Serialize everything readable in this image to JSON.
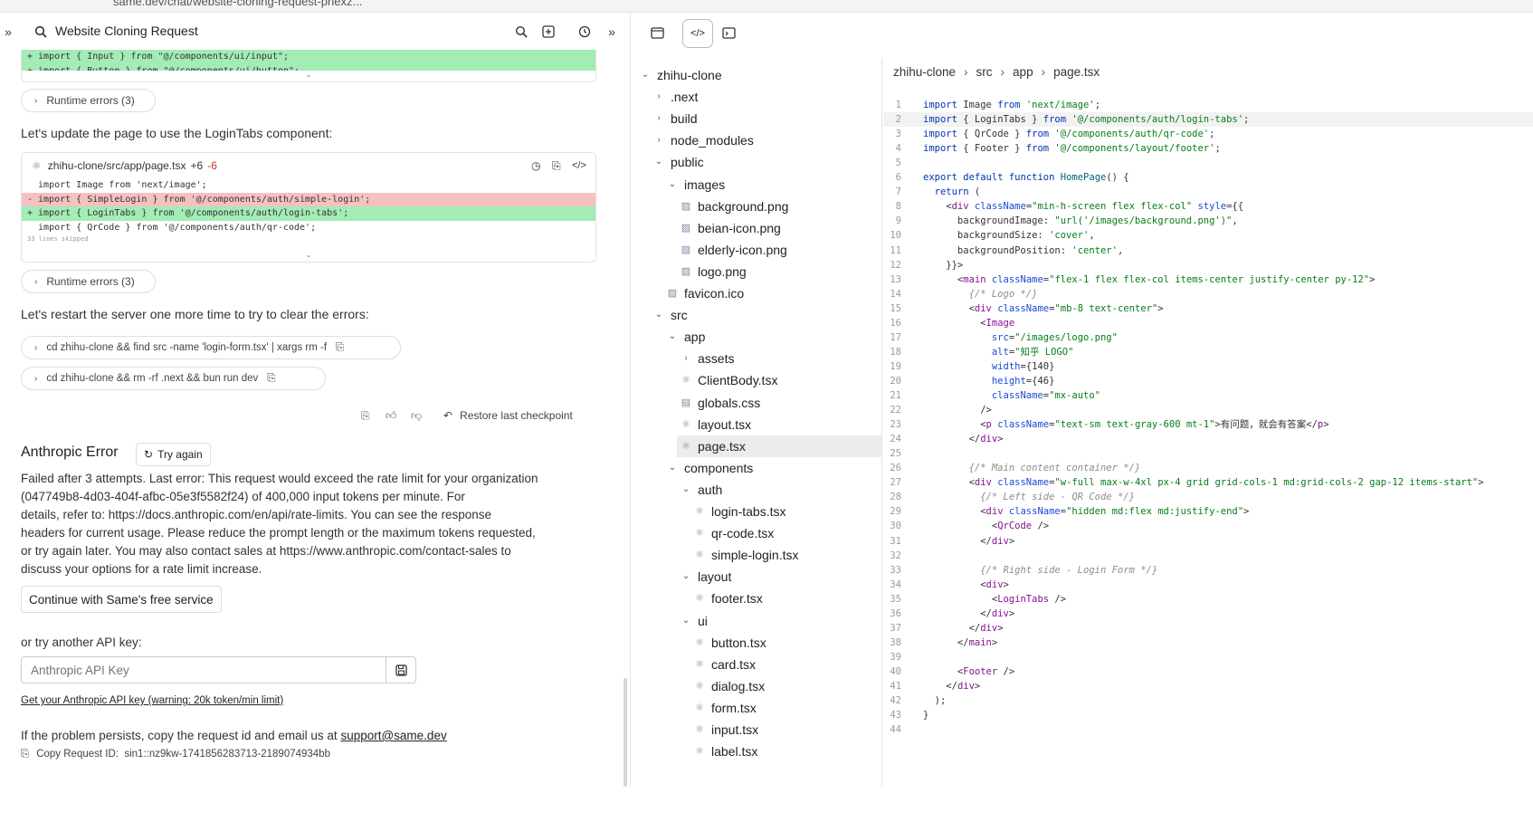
{
  "browser": {
    "url": "same.dev/chat/website-cloning-request-prlexz..."
  },
  "chat": {
    "title": "Website Cloning Request",
    "diff1": {
      "lines": [
        {
          "type": "add",
          "text": "+ import { Input } from \"@/components/ui/input\";"
        },
        {
          "type": "add",
          "text": "+ import { Button } from \"@/components/ui/button\";"
        }
      ]
    },
    "runtime_errors_1": "Runtime errors (3)",
    "msg_update": "Let's update the page to use the LoginTabs component:",
    "diff2": {
      "file": "zhihu-clone/src/app/page.tsx",
      "added": "+6",
      "removed": "-6",
      "lines": [
        {
          "type": "ctx",
          "text": "  import Image from 'next/image';"
        },
        {
          "type": "del",
          "text": "- import { SimpleLogin } from '@/components/auth/simple-login';"
        },
        {
          "type": "add",
          "text": "+ import { LoginTabs } from '@/components/auth/login-tabs';"
        },
        {
          "type": "ctx",
          "text": "  import { QrCode } from '@/components/auth/qr-code';"
        }
      ],
      "skipped": "33 lines skipped"
    },
    "runtime_errors_2": "Runtime errors (3)",
    "msg_restart": "Let's restart the server one more time to try to clear the errors:",
    "cmd1": "cd zhihu-clone && find src -name 'login-form.tsx' | xargs rm -f",
    "cmd2": "cd zhihu-clone && rm -rf .next && bun run dev",
    "restore": "Restore last checkpoint",
    "error_title": "Anthropic Error",
    "try_again": "Try again",
    "error_lines": [
      "Failed after 3 attempts. Last error: This request would exceed the rate limit for your organization",
      "(047749b8-4d03-404f-afbc-05e3f5582f24) of 400,000 input tokens per minute. For",
      "details, refer to: https://docs.anthropic.com/en/api/rate-limits. You can see the response",
      "headers for current usage. Please reduce the prompt length or the maximum tokens requested,",
      "or try again later. You may also contact sales at https://www.anthropic.com/contact-sales to",
      "discuss your options for a rate limit increase."
    ],
    "continue_button": "Continue with Same's free service",
    "or_try": "or try another API key:",
    "api_placeholder": "Anthropic API Key",
    "api_link": "Get your Anthropic API key (warning: 20k token/min limit)",
    "persist_text": "If the problem persists, copy the request id and email us at ",
    "support_email": "support@same.dev",
    "copy_request": "Copy Request ID:",
    "request_id": "sin1::nz9kw-1741856283713-2189074934bb"
  },
  "breadcrumb": [
    "zhihu-clone",
    "src",
    "app",
    "page.tsx"
  ],
  "tree": [
    {
      "label": "zhihu-clone",
      "depth": 0,
      "kind": "open"
    },
    {
      "label": ".next",
      "depth": 1,
      "kind": "closed"
    },
    {
      "label": "build",
      "depth": 1,
      "kind": "closed"
    },
    {
      "label": "node_modules",
      "depth": 1,
      "kind": "closed"
    },
    {
      "label": "public",
      "depth": 1,
      "kind": "open"
    },
    {
      "label": "images",
      "depth": 2,
      "kind": "open"
    },
    {
      "label": "background.png",
      "depth": 3,
      "kind": "img"
    },
    {
      "label": "beian-icon.png",
      "depth": 3,
      "kind": "img"
    },
    {
      "label": "elderly-icon.png",
      "depth": 3,
      "kind": "img"
    },
    {
      "label": "logo.png",
      "depth": 3,
      "kind": "img"
    },
    {
      "label": "favicon.ico",
      "depth": 2,
      "kind": "img"
    },
    {
      "label": "src",
      "depth": 1,
      "kind": "open"
    },
    {
      "label": "app",
      "depth": 2,
      "kind": "open"
    },
    {
      "label": "assets",
      "depth": 3,
      "kind": "closed"
    },
    {
      "label": "ClientBody.tsx",
      "depth": 3,
      "kind": "react"
    },
    {
      "label": "globals.css",
      "depth": 3,
      "kind": "css"
    },
    {
      "label": "layout.tsx",
      "depth": 3,
      "kind": "react"
    },
    {
      "label": "page.tsx",
      "depth": 3,
      "kind": "react",
      "selected": true
    },
    {
      "label": "components",
      "depth": 2,
      "kind": "open"
    },
    {
      "label": "auth",
      "depth": 3,
      "kind": "open"
    },
    {
      "label": "login-tabs.tsx",
      "depth": 4,
      "kind": "react"
    },
    {
      "label": "qr-code.tsx",
      "depth": 4,
      "kind": "react"
    },
    {
      "label": "simple-login.tsx",
      "depth": 4,
      "kind": "react"
    },
    {
      "label": "layout",
      "depth": 3,
      "kind": "open"
    },
    {
      "label": "footer.tsx",
      "depth": 4,
      "kind": "react"
    },
    {
      "label": "ui",
      "depth": 3,
      "kind": "open"
    },
    {
      "label": "button.tsx",
      "depth": 4,
      "kind": "react"
    },
    {
      "label": "card.tsx",
      "depth": 4,
      "kind": "react"
    },
    {
      "label": "dialog.tsx",
      "depth": 4,
      "kind": "react"
    },
    {
      "label": "form.tsx",
      "depth": 4,
      "kind": "react"
    },
    {
      "label": "input.tsx",
      "depth": 4,
      "kind": "react"
    },
    {
      "label": "label.tsx",
      "depth": 4,
      "kind": "react"
    }
  ],
  "code": [
    "import Image from 'next/image';",
    "import { LoginTabs } from '@/components/auth/login-tabs';",
    "import { QrCode } from '@/components/auth/qr-code';",
    "import { Footer } from '@/components/layout/footer';",
    "",
    "export default function HomePage() {",
    "  return (",
    "    <div className=\"min-h-screen flex flex-col\" style={{",
    "      backgroundImage: \"url('/images/background.png')\",",
    "      backgroundSize: 'cover',",
    "      backgroundPosition: 'center',",
    "    }}>",
    "      <main className=\"flex-1 flex flex-col items-center justify-center py-12\">",
    "        {/* Logo */}",
    "        <div className=\"mb-8 text-center\">",
    "          <Image",
    "            src=\"/images/logo.png\"",
    "            alt=\"知乎 LOGO\"",
    "            width={140}",
    "            height={46}",
    "            className=\"mx-auto\"",
    "          />",
    "          <p className=\"text-sm text-gray-600 mt-1\">有问题，就会有答案</p>",
    "        </div>",
    "",
    "        {/* Main content container */}",
    "        <div className=\"w-full max-w-4xl px-4 grid grid-cols-1 md:grid-cols-2 gap-12 items-start\">",
    "          {/* Left side - QR Code */}",
    "          <div className=\"hidden md:flex md:justify-end\">",
    "            <QrCode />",
    "          </div>",
    "",
    "          {/* Right side - Login Form */}",
    "          <div>",
    "            <LoginTabs />",
    "          </div>",
    "        </div>",
    "      </main>",
    "",
    "      <Footer />",
    "    </div>",
    "  );",
    "}",
    ""
  ],
  "active_line": 2
}
